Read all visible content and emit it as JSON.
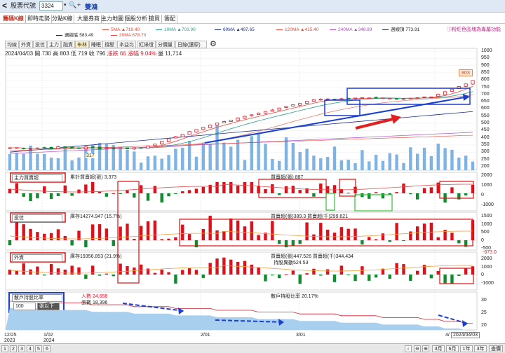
{
  "header": {
    "back": "<",
    "title": "股票代號",
    "stock_code": "3324",
    "stock_name": "雙鴻"
  },
  "tabs": [
    "籌碼K線",
    "即時走勢",
    "分點K線",
    "大量券商",
    "主力地圖",
    "個股分析",
    "搶買",
    "籌配"
  ],
  "active_tab": 0,
  "hint": "ⓘ粉紅色區塊為專屬功能",
  "ma_row1": [
    {
      "label": "5MA ▲719.40",
      "color": "#e8483b"
    },
    {
      "label": "10MA ▲703.90",
      "color": "#2e9e8f"
    },
    {
      "label": "60MA ▲497.65",
      "color": "#1b2d8c"
    },
    {
      "label": "120MA ▲415.40",
      "color": "#e8483b"
    },
    {
      "label": "240MA ▲348.89",
      "color": "#b04fc8"
    },
    {
      "label": "週線頂 773.91",
      "color": "#222222"
    }
  ],
  "ma_row2": [
    {
      "label": "週線底 583.49",
      "color": "#222222"
    },
    {
      "label": "20MA 678.70",
      "color": "#e8483b"
    }
  ],
  "sub_buttons": [
    "均線",
    "外資",
    "投信",
    "主力",
    "融資",
    "布林",
    "睡眠",
    "撐壓",
    "本益比",
    "紅綠燈",
    "分價量"
  ],
  "sub_select": "日線(還原)",
  "gear": "⚙",
  "ohlc": {
    "date": "2024/04/03",
    "open_label": "開",
    "open": "730",
    "high_label": "高",
    "high": "803",
    "low_label": "低",
    "low": "719",
    "close_label": "收",
    "close": "796",
    "chg_label": "漲跌",
    "chg": "66",
    "pct_label": "漲幅",
    "pct": "9.04%",
    "vol_label": "量",
    "vol": "11,714"
  },
  "price_marker": "803",
  "low_marker": "317",
  "y_main": [
    "1000",
    "950",
    "900",
    "850",
    "800",
    "750",
    "700",
    "650",
    "600",
    "550",
    "500",
    "450",
    "400",
    "350",
    "300",
    "250",
    "200"
  ],
  "panel1": {
    "select": "主力買賣超",
    "line_label": "累計買賣超(張) 3,373",
    "bar_label": "買賣超(張) 887",
    "y": [
      "2000",
      "1000",
      "0",
      "-1000"
    ]
  },
  "panel2": {
    "select": "投信",
    "line_label": "庫存14274.947 (15.7%)",
    "bar_label": "買賣超(張)389.3 買賣超(千)299.621",
    "y": [
      "1500",
      "1000",
      "500",
      "0",
      "-500"
    ]
  },
  "panel3": {
    "select": "外資",
    "line_label": "庫存19356.853 (21.9%)",
    "bar_label": "買賣超(張)447.526 買賣超(千)344,434",
    "sub_label": "持股異動524.53",
    "y": [
      "2000",
      "1000",
      "0",
      "-1000"
    ],
    "side_value": "-673.0"
  },
  "panel4": {
    "select": "散戶持股比率",
    "small_select": "100",
    "small_btn": "張以下",
    "people_label": "人數 24,658",
    "lots_label": "張數 18,396",
    "ratio_label": "散戶持股比率 20.17%",
    "y": [
      "30",
      "25",
      "20"
    ]
  },
  "x_labels": [
    {
      "t": "12/25",
      "s": "2023"
    },
    {
      "t": "1/02",
      "s": "2024"
    },
    {
      "t": "2/01",
      "s": ""
    },
    {
      "t": "3/01",
      "s": ""
    },
    {
      "t": "4/",
      "s": ""
    }
  ],
  "date_box": "2024/04/03",
  "pages": [
    "1",
    "2",
    "3",
    "4",
    "5",
    "6"
  ],
  "zoom": [
    "⊖",
    "⊕"
  ],
  "ranges": [
    "3月",
    "6月",
    "1年",
    "3年"
  ],
  "view_label": "查價"
}
